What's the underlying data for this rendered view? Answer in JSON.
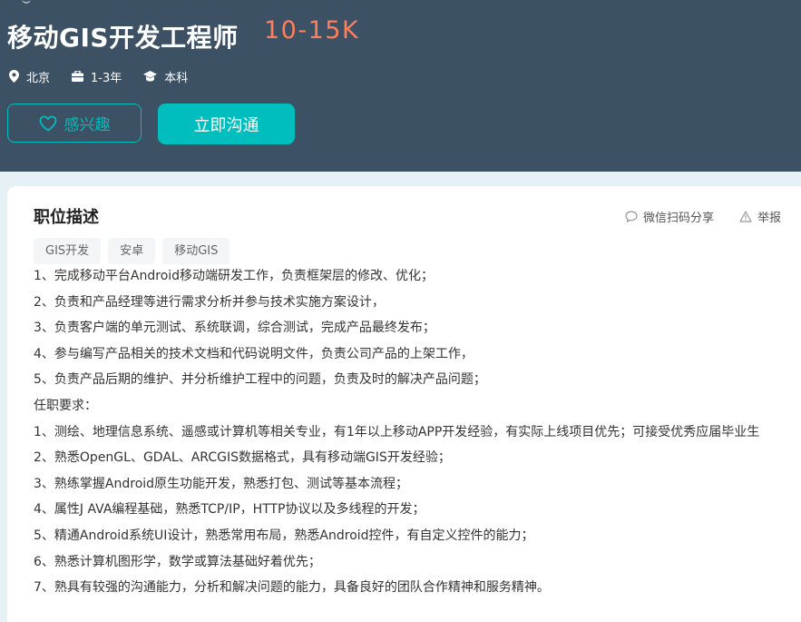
{
  "header": {
    "title": "移动GIS开发工程师",
    "salary": "10-15K",
    "meta": {
      "city": "北京",
      "experience": "1-3年",
      "degree": "本科"
    },
    "interest_label": "感兴趣",
    "chat_label": "立即沟通"
  },
  "colors": {
    "header_bg": "#3d5165",
    "accent": "#00bebd",
    "salary": "#ff7f5c"
  },
  "icons": {
    "location": "location-icon",
    "briefcase": "briefcase-icon",
    "degree": "graduation-cap-icon",
    "heart": "heart-icon",
    "wechat": "chat-bubble-icon",
    "report": "warning-icon"
  },
  "content": {
    "section_title": "职位描述",
    "share_label": "微信扫码分享",
    "report_label": "举报",
    "tags": [
      "GIS开发",
      "安卓",
      "移动GIS"
    ],
    "lines": [
      "1、完成移动平台Android移动端研发工作，负责框架层的修改、优化；",
      "2、负责和产品经理等进行需求分析并参与技术实施方案设计，",
      "3、负责客户端的单元测试、系统联调，综合测试，完成产品最终发布；",
      "4、参与编写产品相关的技术文档和代码说明文件，负责公司产品的上架工作，",
      "5、负责产品后期的维护、并分析维护工程中的问题，负责及时的解决产品问题；",
      "任职要求：",
      "1、测绘、地理信息系统、遥感或计算机等相关专业，有1年以上移动APP开发经验，有实际上线项目优先；可接受优秀应届毕业生",
      "2、熟悉OpenGL、GDAL、ARCGIS数据格式，具有移动端GIS开发经验；",
      "3、熟练掌握Android原生功能开发，熟悉打包、测试等基本流程；",
      "4、属性J AVA编程基础，熟悉TCP/IP，HTTP协议以及多线程的开发；",
      "5、精通Android系统UI设计，熟悉常用布局，熟悉Android控件，有自定义控件的能力；",
      "6、熟悉计算机图形学，数学或算法基础好着优先；",
      "7、熟具有较强的沟通能力，分析和解决问题的能力，具备良好的团队合作精神和服务精神。"
    ]
  }
}
